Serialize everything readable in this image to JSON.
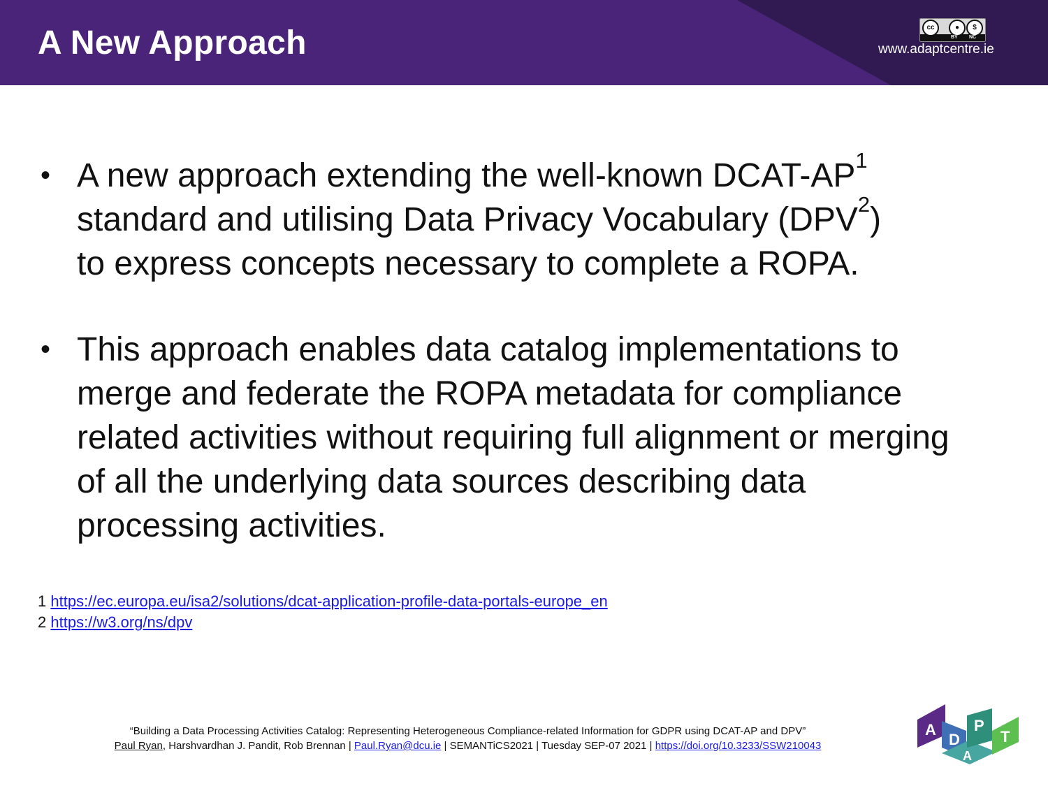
{
  "header": {
    "title": "A New Approach",
    "website": "www.adaptcentre.ie",
    "license_icon": "cc-by-nc-icon",
    "license": {
      "cc": "cc",
      "by": "BY",
      "nc": "NC"
    },
    "colors": {
      "purple": "#4a2479",
      "dark_purple": "#2a1745"
    }
  },
  "bullets": [
    {
      "line1_pre": "A new approach extending the well-known DCAT-AP",
      "sup1": "1",
      "line2_pre": "standard and utilising Data Privacy Vocabulary (DPV",
      "sup2": "2",
      "line2_post": ")",
      "line3": "to express concepts necessary to complete a ROPA."
    },
    {
      "text": "This approach enables data catalog implementations to merge and federate the ROPA metadata for compliance related activities without requiring full alignment or merging of all the underlying data sources describing data processing activities."
    }
  ],
  "footnotes": [
    {
      "num": "1",
      "url": "https://ec.europa.eu/isa2/solutions/dcat-application-profile-data-portals-europe_en"
    },
    {
      "num": "2",
      "url": "https://w3.org/ns/dpv"
    }
  ],
  "credit": {
    "title": "“Building a Data Processing Activities Catalog: Representing Heterogeneous Compliance-related Information for GDPR using DCAT-AP and DPV”",
    "author_link": "Paul Ryan",
    "coauthors": ", Harshvardhan J. Pandit, Rob Brennan | ",
    "email": "Paul.Ryan@dcu.ie",
    "venue": " | SEMANTiCS2021 | Tuesday SEP-07 2021 | ",
    "doi": "https://doi.org/10.3233/SSW210043"
  },
  "logo": {
    "icon": "adapt-logo-icon",
    "letters": [
      "A",
      "D",
      "A",
      "P",
      "T"
    ],
    "colors": [
      "#5a2a86",
      "#3f6fb5",
      "#47a6a0",
      "#2e8f7a",
      "#5cbf4f"
    ]
  }
}
